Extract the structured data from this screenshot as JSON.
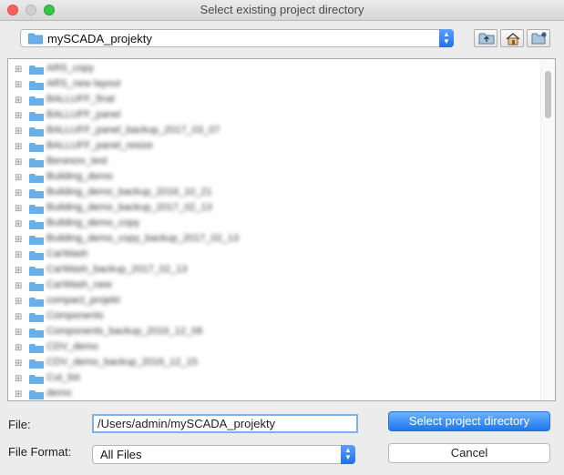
{
  "window": {
    "title": "Select existing project directory"
  },
  "location": {
    "current": "mySCADA_projekty"
  },
  "toolbar": {
    "icons": [
      "folder-up-icon",
      "home-icon",
      "new-folder-icon"
    ]
  },
  "tree": {
    "items": [
      "ARS_copy",
      "ARS_new layout",
      "BALLUFF_final",
      "BALLUFF_panel",
      "BALLUFF_panel_backup_2017_03_07",
      "BALLUFF_panel_resize",
      "Benesov_test",
      "Building_demo",
      "Building_demo_backup_2016_10_21",
      "Building_demo_backup_2017_02_13",
      "Building_demo_copy",
      "Building_demo_copy_backup_2017_02_13",
      "CarWash",
      "CarWash_backup_2017_02_13",
      "CarWash_new",
      "compact_projekt",
      "Components",
      "Components_backup_2016_12_08",
      "CDV_demo",
      "CDV_demo_backup_2016_12_15",
      "Cut_list",
      "demo"
    ]
  },
  "form": {
    "file_label": "File:",
    "file_value": "/Users/admin/mySCADA_projekty",
    "format_label": "File Format:",
    "format_value": "All Files"
  },
  "buttons": {
    "select": "Select project directory",
    "cancel": "Cancel"
  },
  "colors": {
    "folder": "#6ab0e8",
    "accent": "#1d76f0"
  }
}
